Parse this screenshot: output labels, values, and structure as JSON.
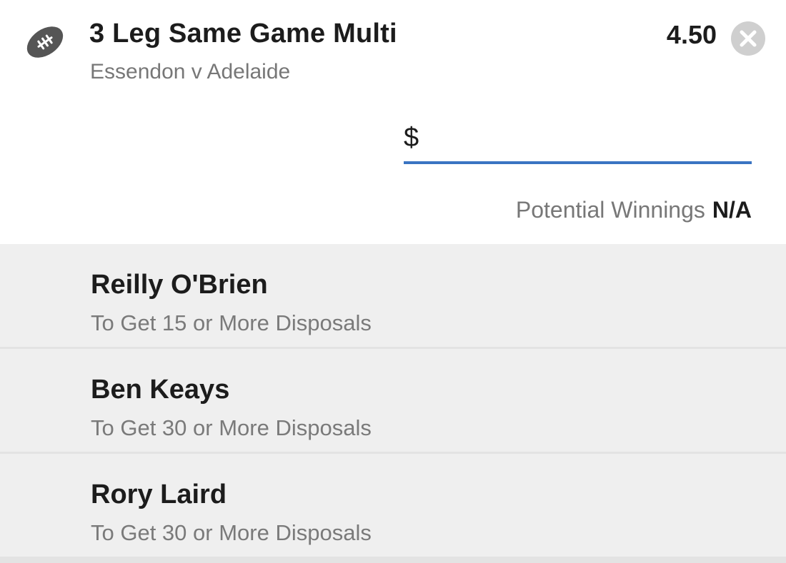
{
  "bet": {
    "title": "3 Leg Same Game Multi",
    "match": "Essendon v Adelaide",
    "odds": "4.50",
    "sport_icon": "football-icon",
    "remove_icon": "close-icon"
  },
  "stake": {
    "currency": "$",
    "value": "",
    "placeholder": ""
  },
  "winnings": {
    "label": "Potential Winnings",
    "value": "N/A"
  },
  "legs": [
    {
      "player": "Reilly O'Brien",
      "selection": "To Get 15 or More Disposals"
    },
    {
      "player": "Ben Keays",
      "selection": "To Get 30 or More Disposals"
    },
    {
      "player": "Rory Laird",
      "selection": "To Get 30 or More Disposals"
    }
  ],
  "colors": {
    "accent": "#3a74c2",
    "legs_background": "#efefef",
    "divider": "#d8d8d8"
  }
}
